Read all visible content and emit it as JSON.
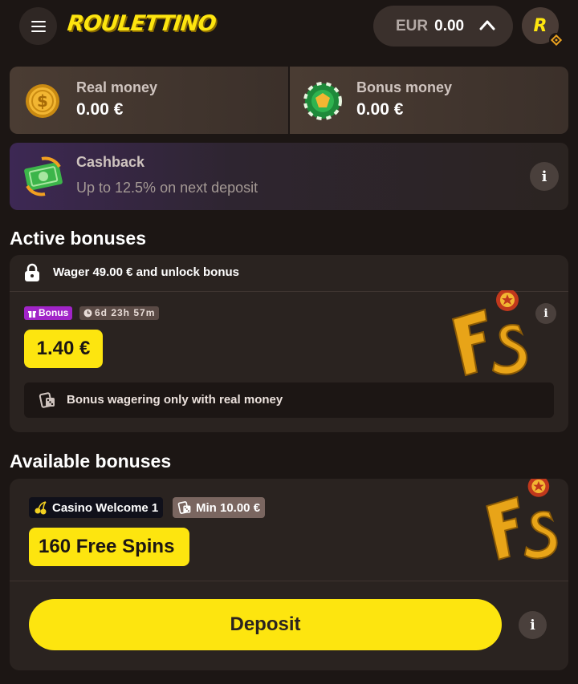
{
  "header": {
    "logo_text": "ROULETTINO",
    "balance_currency": "EUR",
    "balance_amount": "0.00",
    "avatar_letter": "R"
  },
  "wallet": {
    "real_label": "Real money",
    "real_value": "0.00 €",
    "bonus_label": "Bonus money",
    "bonus_value": "0.00 €"
  },
  "cashback": {
    "title": "Cashback",
    "subtitle": "Up to 12.5% on next deposit",
    "info": "i"
  },
  "active_bonuses": {
    "title": "Active bonuses",
    "wager_text": "Wager 49.00 € and unlock bonus",
    "tag_bonus": "Bonus",
    "time_left": "6d 23h 57m",
    "amount": "1.40 €",
    "note": "Bonus wagering only with real money",
    "info": "i"
  },
  "available_bonuses": {
    "title": "Available bonuses",
    "chip_casino": "Casino Welcome 1",
    "chip_min": "Min 10.00 €",
    "amount": "160 Free Spins",
    "deposit_label": "Deposit",
    "info": "i"
  },
  "colors": {
    "accent_yellow": "#fde50f",
    "background": "#1c1614",
    "card": "#2a2320",
    "bonus_tag": "#a124c8"
  },
  "icons": {
    "menu": "hamburger-icon",
    "chevron": "chevron-up-icon",
    "real_money": "gold-coin-icon",
    "bonus_money": "green-chip-icon",
    "cashback": "cash-icon",
    "lock": "lock-icon",
    "wager": "dice-card-icon",
    "casino": "cherry-icon",
    "fs": "free-spins-icon"
  }
}
